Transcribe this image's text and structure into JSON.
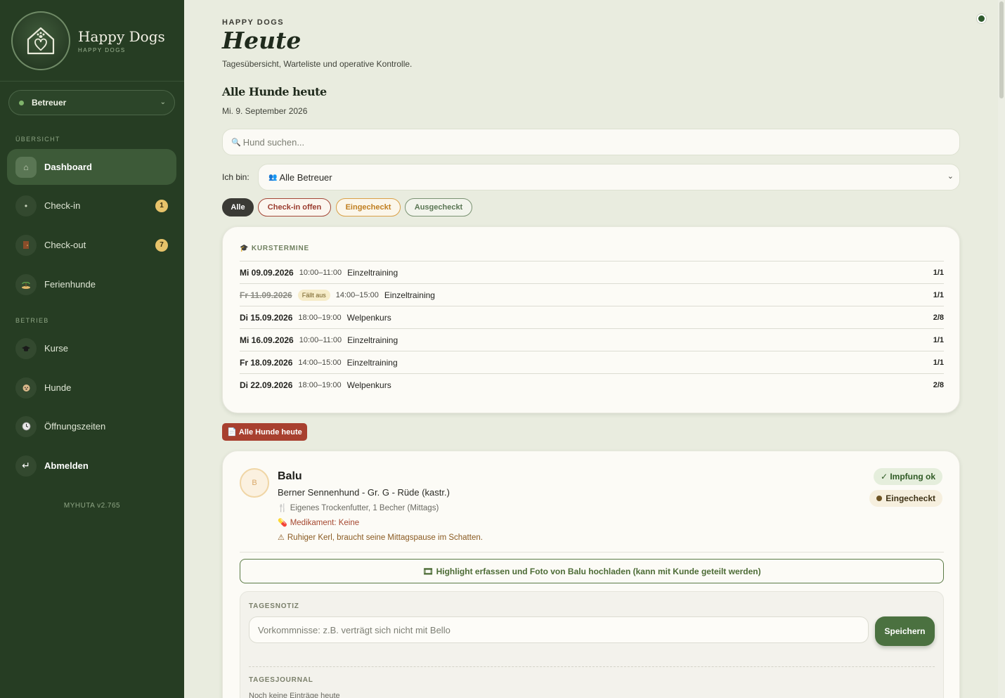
{
  "brand": {
    "title": "Happy Dogs",
    "subtitle": "HAPPY DOGS"
  },
  "role": {
    "selected": "Betreuer"
  },
  "sidebar": {
    "section_overview": "ÜBERSICHT",
    "section_business": "BETRIEB",
    "items": [
      {
        "label": "Dashboard",
        "icon": "home-icon",
        "active": true
      },
      {
        "label": "Check-in",
        "icon": "checkin-icon",
        "badge": "1"
      },
      {
        "label": "Check-out",
        "icon": "door-icon",
        "badge": "7"
      },
      {
        "label": "Ferienhunde",
        "icon": "island-icon"
      },
      {
        "label": "Kurse",
        "icon": "graduation-cap-icon"
      },
      {
        "label": "Hunde",
        "icon": "dog-icon"
      },
      {
        "label": "Öffnungszeiten",
        "icon": "clock-icon"
      },
      {
        "label": "Abmelden",
        "icon": "logout-icon"
      }
    ],
    "version": "MYHUTA v2.765"
  },
  "header": {
    "eyebrow": "HAPPY DOGS",
    "title": "Heute",
    "subtitle": "Tagesübersicht, Warteliste und operative Kontrolle."
  },
  "section": {
    "title": "Alle Hunde heute",
    "date": "Mi. 9. September 2026"
  },
  "search": {
    "placeholder": "Hund suchen..."
  },
  "filter": {
    "label": "Ich bin:",
    "selected": "Alle Betreuer"
  },
  "chips": [
    "Alle",
    "Check-in offen",
    "Eingecheckt",
    "Ausgecheckt"
  ],
  "courses": {
    "heading": "KURSTERMINE",
    "rows": [
      {
        "date": "Mi 09.09.2026",
        "time": "10:00–11:00",
        "name": "Einzeltraining",
        "count": "1/1",
        "cancelled": false
      },
      {
        "date": "Fr 11.09.2026",
        "tag": "Fällt aus",
        "time": "14:00–15:00",
        "name": "Einzeltraining",
        "count": "1/1",
        "cancelled": true
      },
      {
        "date": "Di 15.09.2026",
        "time": "18:00–19:00",
        "name": "Welpenkurs",
        "count": "2/8",
        "cancelled": false
      },
      {
        "date": "Mi 16.09.2026",
        "time": "10:00–11:00",
        "name": "Einzeltraining",
        "count": "1/1",
        "cancelled": false
      },
      {
        "date": "Fr 18.09.2026",
        "time": "14:00–15:00",
        "name": "Einzeltraining",
        "count": "1/1",
        "cancelled": false
      },
      {
        "date": "Di 22.09.2026",
        "time": "18:00–19:00",
        "name": "Welpenkurs",
        "count": "2/8",
        "cancelled": false
      }
    ]
  },
  "all_dogs_button": "Alle Hunde heute",
  "dog": {
    "initial": "B",
    "name": "Balu",
    "breed": "Berner Sennenhund - Gr. G - Rüde (kastr.)",
    "food": "Eigenes Trockenfutter, 1 Becher (Mittags)",
    "medication": "Medikament: Keine",
    "note": "Ruhiger Kerl, braucht seine Mittagspause im Schatten.",
    "vaccination": "✓ Impfung ok",
    "status": "Eingecheckt",
    "highlight_button": "Highlight erfassen und Foto von Balu hochladen (kann mit Kunde geteilt werden)",
    "day_note_label": "TAGESNOTIZ",
    "day_note_placeholder": "Vorkommnisse: z.B. verträgt sich nicht mit Bello",
    "save_label": "Speichern",
    "journal_label": "TAGESJOURNAL",
    "journal_empty": "Noch keine Einträge heute"
  },
  "colors": {
    "sidebar": "#263d23",
    "accent": "#4b7140",
    "danger": "#a8402f",
    "warning": "#d9a047"
  }
}
